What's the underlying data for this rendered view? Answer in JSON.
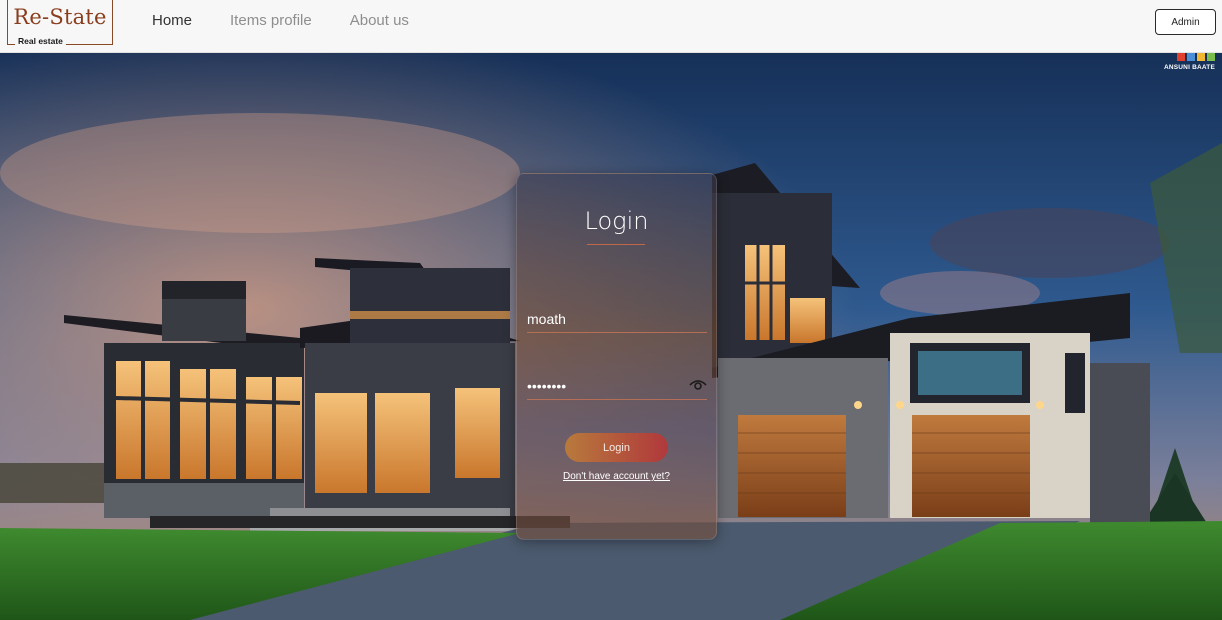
{
  "navbar": {
    "logo_title": "Re-State",
    "logo_subtitle": "Real estate",
    "links": [
      {
        "label": "Home",
        "active": true
      },
      {
        "label": "Items profile",
        "active": false
      },
      {
        "label": "About us",
        "active": false
      }
    ],
    "admin_label": "Admin"
  },
  "hero": {
    "badge_text": "ANSUNI BAATE",
    "badge_colors": [
      "#e0412f",
      "#4b8fd6",
      "#f2b632",
      "#7bbd4a"
    ]
  },
  "login": {
    "title": "Login",
    "username_value": "moath",
    "password_value": "moath123",
    "button_label": "Login",
    "signup_link": "Don't have account yet?",
    "eye_icon": "eye-icon"
  },
  "colors": {
    "accent": "#8a3d1c",
    "button_gradient_start": "#b87a3c",
    "button_gradient_end": "#b0383c"
  }
}
